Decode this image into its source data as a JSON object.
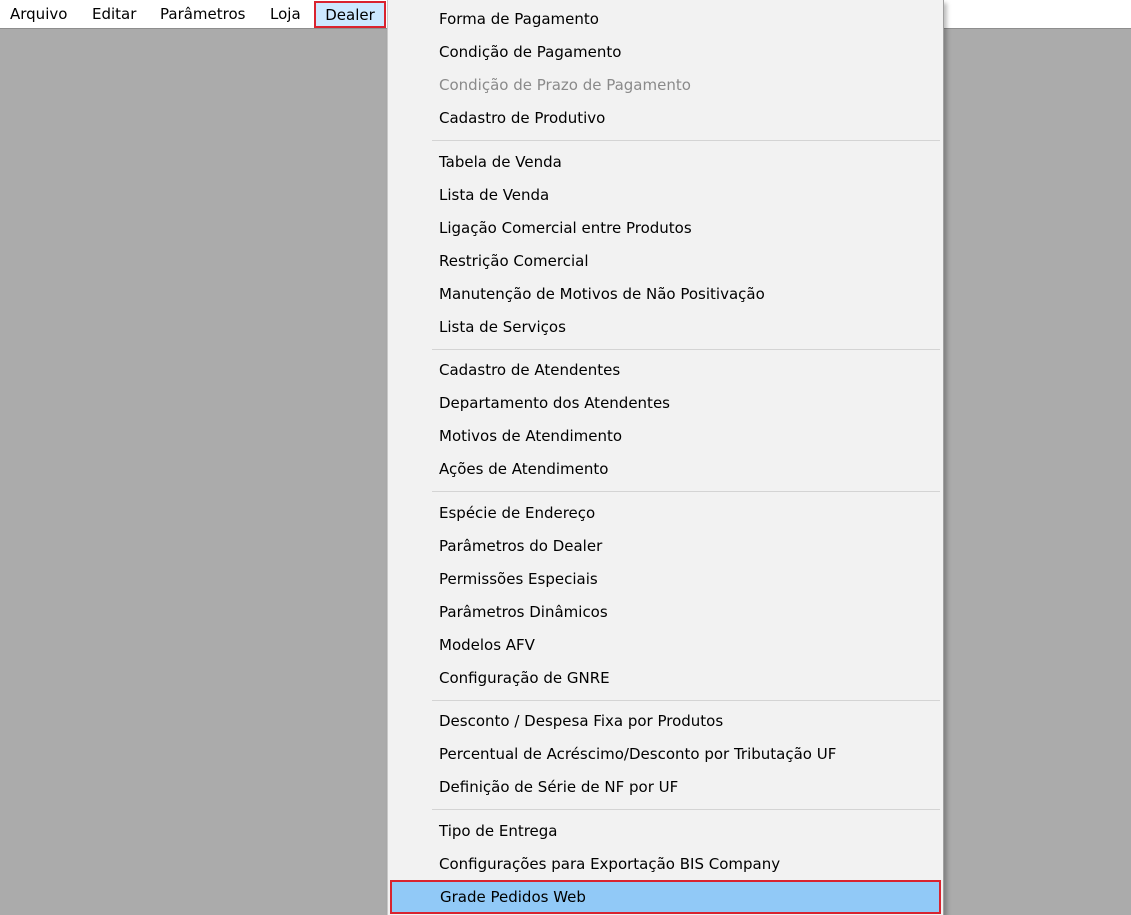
{
  "menubar": {
    "items": [
      {
        "label": "Arquivo"
      },
      {
        "label": "Editar"
      },
      {
        "label": "Parâmetros"
      },
      {
        "label": "Loja"
      },
      {
        "label": "Dealer"
      }
    ],
    "active_index": 4
  },
  "dealer_menu": {
    "groups": [
      {
        "items": [
          {
            "label": "Forma de Pagamento",
            "enabled": true
          },
          {
            "label": "Condição de Pagamento",
            "enabled": true
          },
          {
            "label": "Condição de Prazo de Pagamento",
            "enabled": false
          },
          {
            "label": "Cadastro de Produtivo",
            "enabled": true
          }
        ]
      },
      {
        "items": [
          {
            "label": "Tabela de Venda",
            "enabled": true
          },
          {
            "label": "Lista de Venda",
            "enabled": true
          },
          {
            "label": "Ligação Comercial entre Produtos",
            "enabled": true
          },
          {
            "label": "Restrição Comercial",
            "enabled": true
          },
          {
            "label": "Manutenção de Motivos de Não Positivação",
            "enabled": true
          },
          {
            "label": "Lista de Serviços",
            "enabled": true
          }
        ]
      },
      {
        "items": [
          {
            "label": "Cadastro de Atendentes",
            "enabled": true
          },
          {
            "label": "Departamento dos Atendentes",
            "enabled": true
          },
          {
            "label": "Motivos de Atendimento",
            "enabled": true
          },
          {
            "label": "Ações de Atendimento",
            "enabled": true
          }
        ]
      },
      {
        "items": [
          {
            "label": "Espécie de Endereço",
            "enabled": true
          },
          {
            "label": "Parâmetros do Dealer",
            "enabled": true
          },
          {
            "label": "Permissões Especiais",
            "enabled": true
          },
          {
            "label": "Parâmetros Dinâmicos",
            "enabled": true
          },
          {
            "label": "Modelos AFV",
            "enabled": true
          },
          {
            "label": "Configuração de GNRE",
            "enabled": true
          }
        ]
      },
      {
        "items": [
          {
            "label": "Desconto / Despesa Fixa por Produtos",
            "enabled": true
          },
          {
            "label": "Percentual de Acréscimo/Desconto por Tributação UF",
            "enabled": true
          },
          {
            "label": "Definição de Série de NF por UF",
            "enabled": true
          }
        ]
      },
      {
        "items": [
          {
            "label": "Tipo de Entrega",
            "enabled": true
          },
          {
            "label": "Configurações para Exportação BIS Company",
            "enabled": true
          },
          {
            "label": "Grade Pedidos Web",
            "enabled": true,
            "highlighted": true
          }
        ]
      }
    ]
  },
  "colors": {
    "desktop_background": "#ababab",
    "menu_background": "#f2f2f2",
    "highlight": "#91c9f7",
    "annotation_box": "#d9232f",
    "disabled_text": "#8a8a8a"
  }
}
